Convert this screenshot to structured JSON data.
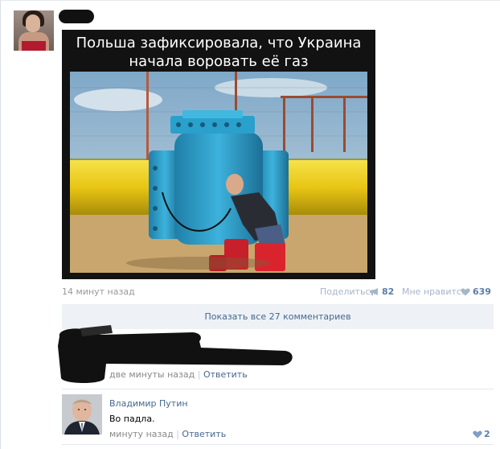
{
  "post": {
    "meme_caption_line1": "Польша зафиксировала, что Украина",
    "meme_caption_line2": "начала воровать её газ",
    "time": "14 минут назад",
    "share_label": "Поделиться",
    "share_count": "82",
    "like_label": "Мне нравится",
    "like_count": "639"
  },
  "comments_bar": {
    "label": "Показать все 27 комментариев"
  },
  "comments": [
    {
      "time": "две минуты назад",
      "separator": "|",
      "reply_label": "Ответить"
    },
    {
      "author": "Владимир Путин",
      "text": "Во падла.",
      "time": "минуту назад",
      "separator": "|",
      "reply_label": "Ответить",
      "likes": "2"
    }
  ],
  "icons": {
    "share": "megaphone-icon",
    "like": "heart-icon",
    "comment_like": "heart-icon"
  },
  "colors": {
    "link_blue": "#45688e",
    "muted_gray": "#999999",
    "bar_background": "#eef1f5",
    "pipe_yellow": "#f2d21a",
    "valve_blue": "#2b97c2"
  }
}
